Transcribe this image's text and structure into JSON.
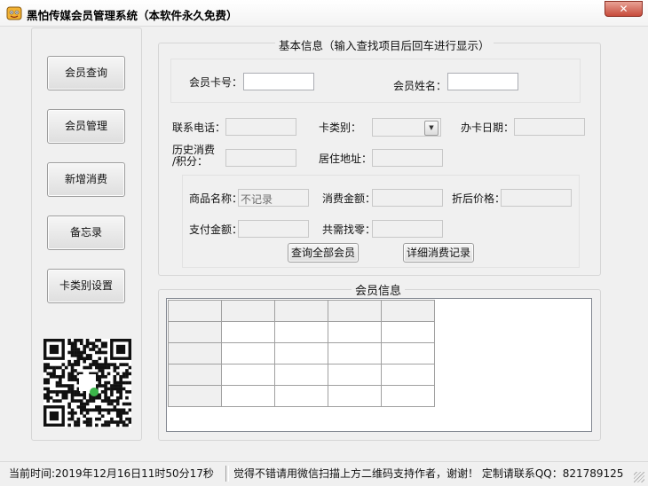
{
  "window": {
    "title": "黑怕传媒会员管理系统（本软件永久免费）",
    "close_label": "✕"
  },
  "sidebar": {
    "buttons": [
      {
        "label": "会员查询"
      },
      {
        "label": "会员管理"
      },
      {
        "label": "新增消费"
      },
      {
        "label": "备忘录"
      },
      {
        "label": "卡类别设置"
      }
    ]
  },
  "basic_info": {
    "title": "基本信息（输入查找项目后回车进行显示）",
    "card_no_label": "会员卡号：",
    "card_no_value": "",
    "name_label": "会员姓名：",
    "name_value": "",
    "phone_label": "联系电话：",
    "card_type_label": "卡类别：",
    "open_date_label": "办卡日期：",
    "history_label_line1": "历史消费",
    "history_label_line2": "/积分：",
    "address_label": "居住地址："
  },
  "consumption": {
    "product_label": "商品名称：",
    "product_value": "不记录",
    "amount_label": "消费金额：",
    "discount_label": "折后价格：",
    "paid_label": "支付金额：",
    "change_label": "共需找零：",
    "query_all_button": "查询全部会员",
    "detail_button": "详细消费记录"
  },
  "member_info": {
    "title": "会员信息"
  },
  "status": {
    "time": "当前时间:2019年12月16日11时50分17秒",
    "message": "觉得不错请用微信扫描上方二维码支持作者，谢谢！  定制请联系QQ：821789125"
  },
  "colors": {
    "background": "#f0f0f0",
    "close_button": "#c74b3b",
    "field_border": "#abadb3"
  }
}
